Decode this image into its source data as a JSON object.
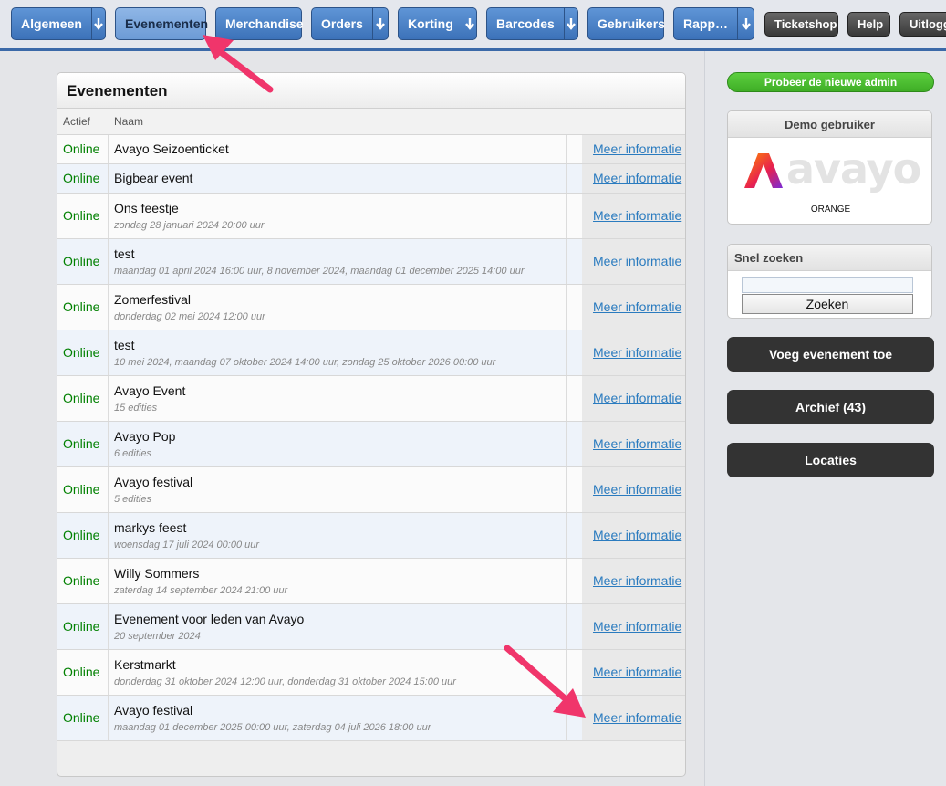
{
  "nav": {
    "items": [
      {
        "label": "Algemeen",
        "dropdown": true
      },
      {
        "label": "Evenementen",
        "dropdown": false,
        "active": true
      },
      {
        "label": "Merchandise",
        "dropdown": false
      },
      {
        "label": "Orders",
        "dropdown": true
      },
      {
        "label": "Korting",
        "dropdown": true
      },
      {
        "label": "Barcodes",
        "dropdown": true
      },
      {
        "label": "Gebruikers",
        "dropdown": false
      },
      {
        "label": "Rapp…",
        "dropdown": true
      }
    ],
    "ticketshop": "Ticketshop",
    "help": "Help",
    "logout": "Uitlogg"
  },
  "main": {
    "title": "Evenementen",
    "columns": {
      "status": "Actief",
      "name": "Naam"
    },
    "info_label": "Meer informatie",
    "rows": [
      {
        "status": "Online",
        "name": "Avayo Seizoenticket",
        "sub": ""
      },
      {
        "status": "Online",
        "name": "Bigbear event",
        "sub": ""
      },
      {
        "status": "Online",
        "name": "Ons feestje",
        "sub": "zondag 28 januari 2024 20:00 uur"
      },
      {
        "status": "Online",
        "name": "test",
        "sub": "maandag 01 april 2024 16:00 uur, 8 november 2024, maandag 01 december 2025 14:00 uur"
      },
      {
        "status": "Online",
        "name": "Zomerfestival",
        "sub": "donderdag 02 mei 2024 12:00 uur"
      },
      {
        "status": "Online",
        "name": "test",
        "sub": "10 mei 2024, maandag 07 oktober 2024 14:00 uur, zondag 25 oktober 2026 00:00 uur"
      },
      {
        "status": "Online",
        "name": "Avayo Event",
        "sub": "15 edities"
      },
      {
        "status": "Online",
        "name": "Avayo Pop",
        "sub": "6 edities"
      },
      {
        "status": "Online",
        "name": "Avayo festival",
        "sub": "5 edities"
      },
      {
        "status": "Online",
        "name": "markys feest",
        "sub": "woensdag 17 juli 2024 00:00 uur"
      },
      {
        "status": "Online",
        "name": "Willy Sommers",
        "sub": "zaterdag 14 september 2024 21:00 uur"
      },
      {
        "status": "Online",
        "name": "Evenement voor leden van Avayo",
        "sub": "20 september 2024"
      },
      {
        "status": "Online",
        "name": "Kerstmarkt",
        "sub": "donderdag 31 oktober 2024 12:00 uur, donderdag 31 oktober 2024 15:00 uur"
      },
      {
        "status": "Online",
        "name": "Avayo festival",
        "sub": "maandag 01 december 2025 00:00 uur, zaterdag 04 juli 2026 18:00 uur"
      }
    ]
  },
  "sidebar": {
    "new_admin": "Probeer de nieuwe admin",
    "demo": {
      "title": "Demo gebruiker",
      "logo_text": "avayo",
      "org": "ORANGE"
    },
    "search": {
      "title": "Snel zoeken",
      "value": "",
      "button": "Zoeken"
    },
    "add_event": "Voeg evenement toe",
    "archive": "Archief (43)",
    "locations": "Locaties"
  },
  "colors": {
    "accent": "#3c72b9",
    "online": "#008000",
    "link": "#2a7bbf",
    "annotation": "#f0356b"
  }
}
